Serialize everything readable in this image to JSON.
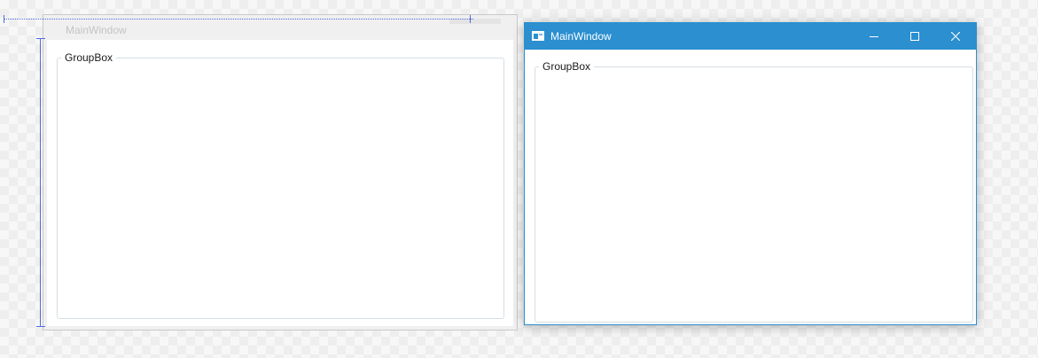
{
  "designer": {
    "window_title": "MainWindow",
    "groupbox_header": "GroupBox"
  },
  "runtime": {
    "window_title": "MainWindow",
    "groupbox_header": "GroupBox",
    "icons": {
      "app": "window-app-icon",
      "minimize": "minimize-icon",
      "maximize": "maximize-icon",
      "close": "close-icon"
    }
  },
  "colors": {
    "titlebar": "#2b8fd0",
    "window_border": "#2b8ed0",
    "groupbox_border": "#d5dfe5",
    "design_guides": "#4f6bd8"
  }
}
